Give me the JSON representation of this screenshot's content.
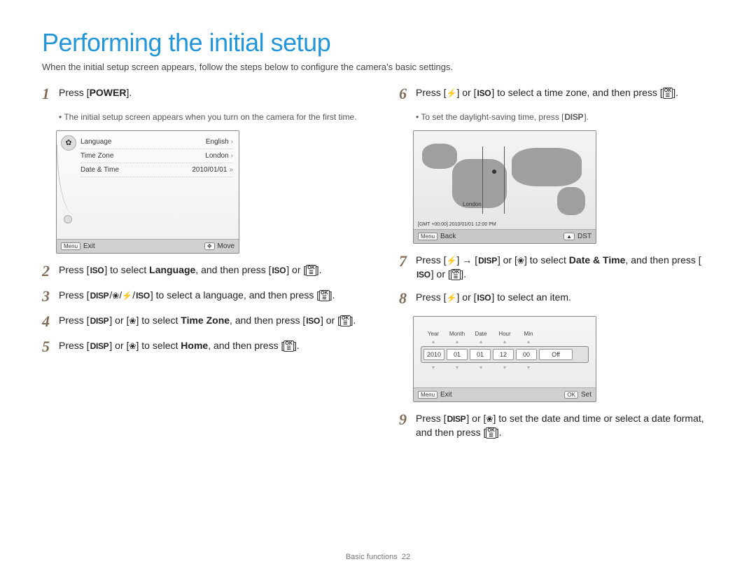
{
  "title": "Performing the initial setup",
  "subtitle": "When the initial setup screen appears, follow the steps below to configure the camera's basic settings.",
  "icons": {
    "iso": "ISO",
    "disp": "DISP",
    "ok_top": "OK",
    "ok_bot": "☰"
  },
  "steps_left": {
    "s1": {
      "num": "1",
      "pre": "Press [",
      "bold": "POWER",
      "post": "]."
    },
    "s1_bullet": "The initial setup screen appears when you turn on the camera for the first time.",
    "s2": {
      "num": "2",
      "pre": "Press [",
      "mid1": "] to select ",
      "bold": "Language",
      "mid2": ", and then press [",
      "mid3": "] or [",
      "post": "]."
    },
    "s3": {
      "num": "3",
      "pre": "Press [",
      "mid1": "] to select a language, and then press [",
      "post": "]."
    },
    "s4": {
      "num": "4",
      "pre": "Press [",
      "mid1": "] or [",
      "mid2": "] to select ",
      "bold": "Time Zone",
      "mid3": ", and then press [",
      "mid4": "] or [",
      "post": "]."
    },
    "s5": {
      "num": "5",
      "pre": "Press [",
      "mid1": "] or [",
      "mid2": "] to select ",
      "bold": "Home",
      "mid3": ", and then press [",
      "post": "]."
    }
  },
  "steps_right": {
    "s6": {
      "num": "6",
      "pre": "Press [",
      "mid1": "] or [",
      "mid2": "] to select a time zone, and then press [",
      "post": "]."
    },
    "s6_bullet_pre": "To set the daylight-saving time, press [",
    "s6_bullet_post": "].",
    "s7": {
      "num": "7",
      "pre": "Press [",
      "mid1": "] → [",
      "mid2": "] or [",
      "mid3": "] to select ",
      "bold": "Date & Time",
      "mid4": ", and then press [",
      "mid5": "] or [",
      "post": "]."
    },
    "s8": {
      "num": "8",
      "pre": "Press [",
      "mid1": "] or [",
      "mid2": "] to select an item."
    },
    "s9": {
      "num": "9",
      "pre": "Press [",
      "mid1": "] or [",
      "mid2": "] to set the date and time or select a date format, and then press [",
      "post": "]."
    }
  },
  "screen1": {
    "rows": [
      {
        "label": "Language",
        "value": "English"
      },
      {
        "label": "Time Zone",
        "value": "London"
      },
      {
        "label": "Date & Time",
        "value": "2010/01/01"
      }
    ],
    "bar_left_btn": "Menu",
    "bar_left": "Exit",
    "bar_right_btn": "✥",
    "bar_right": "Move"
  },
  "screen_map": {
    "city": "London",
    "status": "[GMT +00:00] 2010/01/01 12:00 PM",
    "bar_left_btn": "Menu",
    "bar_left": "Back",
    "bar_right_btn": "▲",
    "bar_right": "DST"
  },
  "screen_dt": {
    "labels": [
      "Year",
      "Month",
      "Date",
      "Hour",
      "Min",
      ""
    ],
    "cells": [
      "2010",
      "01",
      "01",
      "12",
      "00",
      "Off"
    ],
    "bar_left_btn": "Menu",
    "bar_left": "Exit",
    "bar_right_btn": "OK",
    "bar_right": "Set"
  },
  "footer": {
    "section": "Basic functions",
    "page": "22"
  }
}
